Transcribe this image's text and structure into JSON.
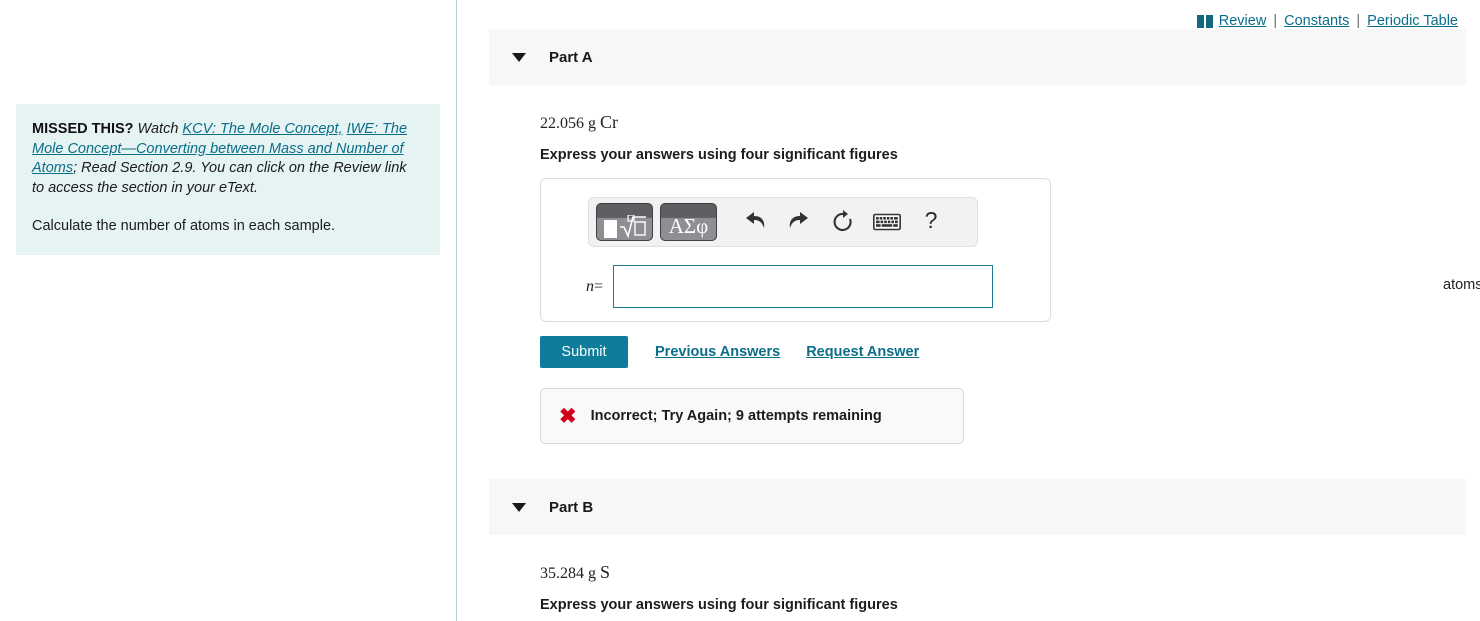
{
  "toplinks": {
    "review": " Review",
    "sep": "|",
    "constants": "Constants",
    "periodic_table": "Periodic Table"
  },
  "hint": {
    "missed_label": "MISSED THIS?",
    "watch_label": "Watch",
    "link1": "KCV: The Mole Concept,",
    "link2": "IWE: The Mole Concept—Converting between Mass and Number of Atoms",
    "tail": "; Read Section 2.9. You can click on the Review link to access the section in your eText.",
    "task": "Calculate the number of atoms in each sample."
  },
  "parts": [
    {
      "title": "Part A",
      "question_value": "22.056 g",
      "question_symbol": "Cr",
      "instruction": "Express your answers using four significant figures"
    },
    {
      "title": "Part B",
      "question_value": "35.284 g",
      "question_symbol": "S",
      "instruction": "Express your answers using four significant figures"
    }
  ],
  "answer_area": {
    "toolbar": {
      "template_button": "math-template",
      "greek_button": "ΑΣφ",
      "undo": "undo",
      "redo": "redo",
      "reset": "reset",
      "keyboard": "keyboard",
      "help": "?"
    },
    "variable_label": "n",
    "equals": "=",
    "input_value": "",
    "input_placeholder": "",
    "units": "atoms"
  },
  "actions": {
    "submit": "Submit",
    "previous_answers": "Previous Answers",
    "request_answer": "Request Answer"
  },
  "feedback": {
    "icon": "✖",
    "text": "Incorrect; Try Again; 9 attempts remaining"
  },
  "colors": {
    "accent_teal": "#0e7c9b",
    "link": "#0b6e8a",
    "hint_bg": "#e6f3f3",
    "header_bg": "#f7f7f7",
    "error_red": "#d0021b"
  }
}
